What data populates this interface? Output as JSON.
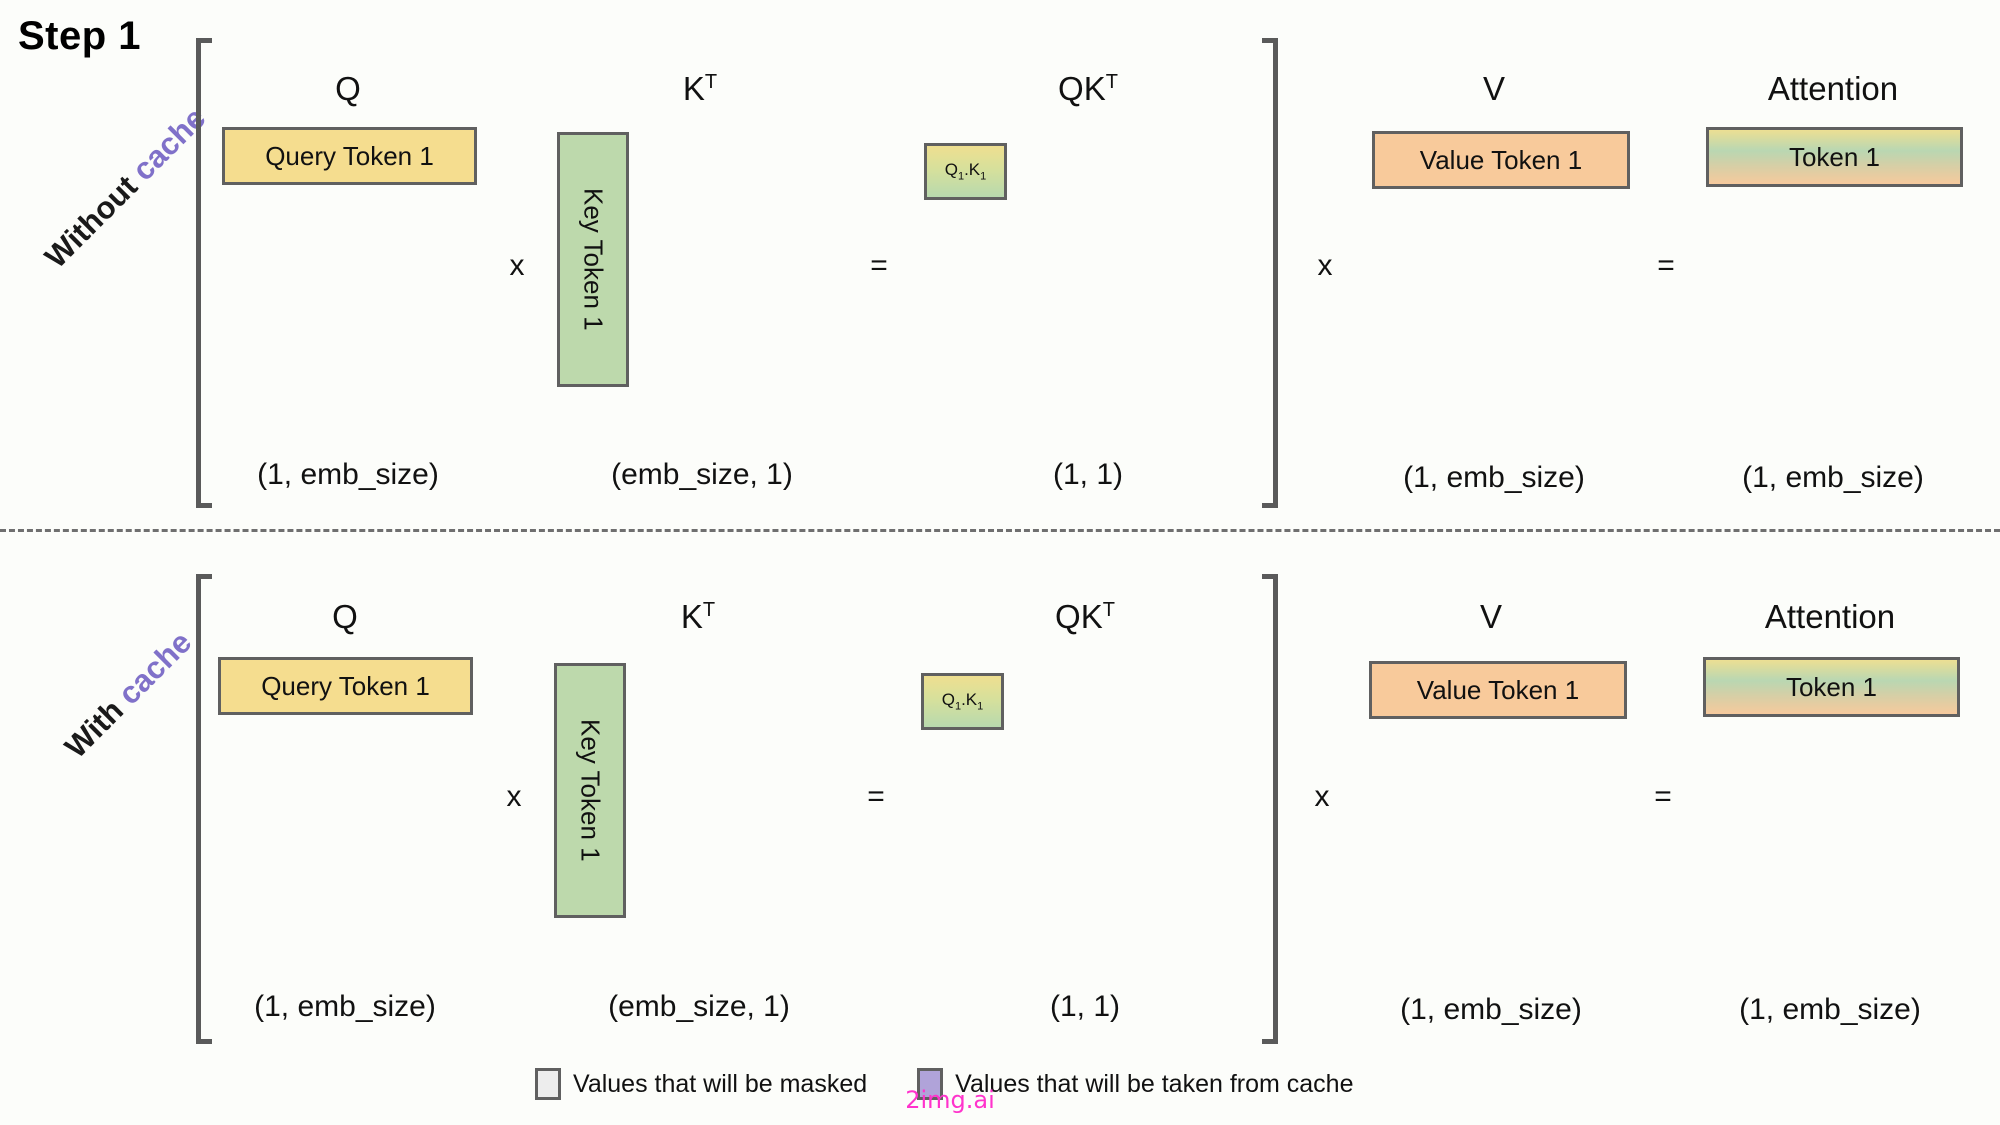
{
  "title": "Step 1",
  "row_labels": {
    "without": {
      "prefix": "Without",
      "accent": "cache"
    },
    "with": {
      "prefix": "With",
      "accent": "cache"
    }
  },
  "colors": {
    "query": "#f5dd8f",
    "key": "#bdd9ac",
    "value": "#f8ca9b",
    "border": "#606060",
    "bracket": "#5a5a5a",
    "accent_purple": "#8071c9",
    "masked_swatch": "#ededed",
    "cache_swatch": "#b0a3d9",
    "watermark": "#ff33cc"
  },
  "headers": {
    "q": "Q",
    "kt_base": "K",
    "kt_sup": "T",
    "qkt_base": "QK",
    "qkt_sup": "T",
    "v": "V",
    "attention": "Attention"
  },
  "rows": [
    {
      "id": "without-cache",
      "boxes": {
        "query": "Query Token 1",
        "key": "Key Token 1",
        "qk_base": "Q",
        "qk_sub1": "1",
        "qk_mid": ".K",
        "qk_sub2": "1",
        "value": "Value Token 1",
        "attention": "Token 1"
      },
      "operators": {
        "mul1": "x",
        "eq1": "=",
        "mul2": "x",
        "eq2": "="
      },
      "shapes": {
        "q": "(1, emb_size)",
        "kt": "(emb_size, 1)",
        "qkt": "(1, 1)",
        "v": "(1, emb_size)",
        "attention": "(1, emb_size)"
      }
    },
    {
      "id": "with-cache",
      "boxes": {
        "query": "Query Token 1",
        "key": "Key Token 1",
        "qk_base": "Q",
        "qk_sub1": "1",
        "qk_mid": ".K",
        "qk_sub2": "1",
        "value": "Value Token 1",
        "attention": "Token 1"
      },
      "operators": {
        "mul1": "x",
        "eq1": "=",
        "mul2": "x",
        "eq2": "="
      },
      "shapes": {
        "q": "(1, emb_size)",
        "kt": "(emb_size, 1)",
        "qkt": "(1, 1)",
        "v": "(1, emb_size)",
        "attention": "(1, emb_size)"
      }
    }
  ],
  "legend": {
    "masked": "Values that will be masked",
    "cache": "Values that will be taken from cache"
  },
  "watermark": "2img.ai"
}
